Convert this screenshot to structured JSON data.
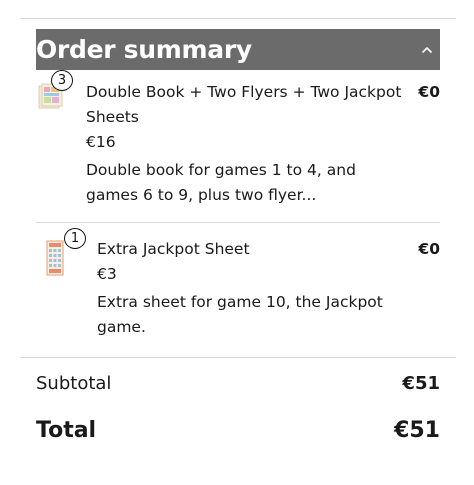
{
  "summary": {
    "title": "Order summary",
    "toggle_icon": "chevron-up-icon"
  },
  "items": [
    {
      "quantity": "3",
      "name": "Double Book + Two Flyers + Two Jackpot Sheets",
      "price": "€16",
      "description": "Double book for games 1 to 4, and games 6 to 9, plus two flyer...",
      "line_total": "€0",
      "thumbnail_icon": "ticket-book-thumbnail"
    },
    {
      "quantity": "1",
      "name": "Extra Jackpot Sheet",
      "price": "€3",
      "description": "Extra sheet for game 10, the Jackpot game.",
      "line_total": "€0",
      "thumbnail_icon": "jackpot-sheet-thumbnail"
    }
  ],
  "totals": {
    "subtotal_label": "Subtotal",
    "subtotal_value": "€51",
    "total_label": "Total",
    "total_value": "€51"
  }
}
